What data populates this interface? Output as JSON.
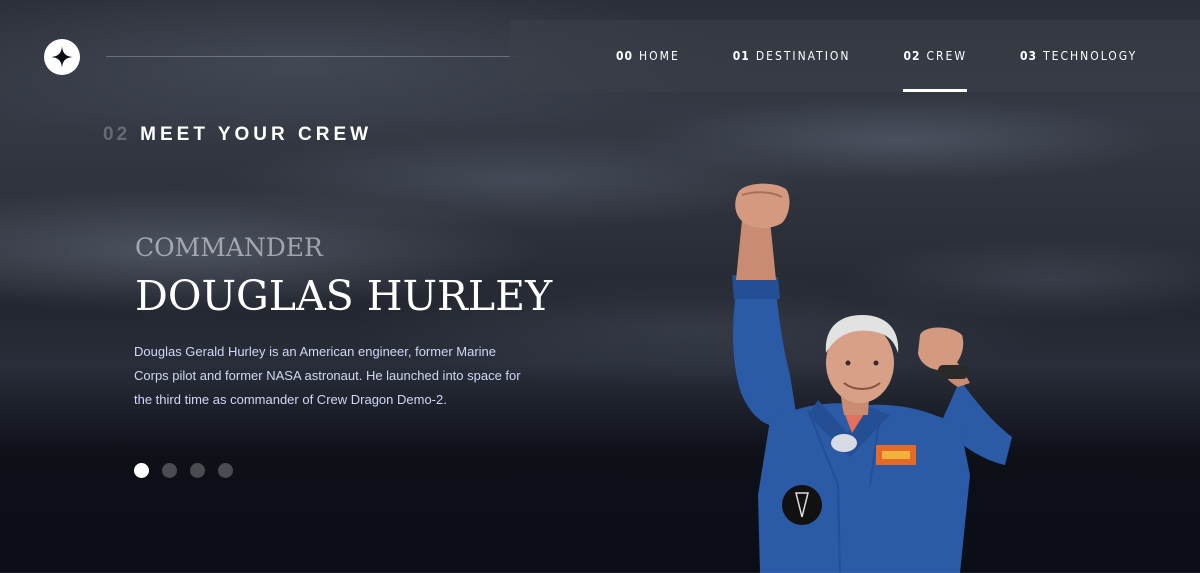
{
  "header": {
    "nav": [
      {
        "num": "00",
        "label": "HOME"
      },
      {
        "num": "01",
        "label": "DESTINATION"
      },
      {
        "num": "02",
        "label": "CREW",
        "active": true
      },
      {
        "num": "03",
        "label": "TECHNOLOGY"
      }
    ]
  },
  "section": {
    "num": "02",
    "title": "MEET YOUR CREW"
  },
  "crew": {
    "role": "Commander",
    "name": "Douglas Hurley",
    "bio": "Douglas Gerald Hurley is an American engineer, former Marine Corps pilot and former NASA astronaut. He launched into space for the third time as commander of Crew Dragon Demo-2."
  },
  "carousel": {
    "count": 4,
    "active_index": 0
  },
  "colors": {
    "background": "#0b0d17",
    "accent": "#ffffff",
    "muted_text": "#d0d6f9",
    "suit_blue": "#2a5aa8"
  }
}
